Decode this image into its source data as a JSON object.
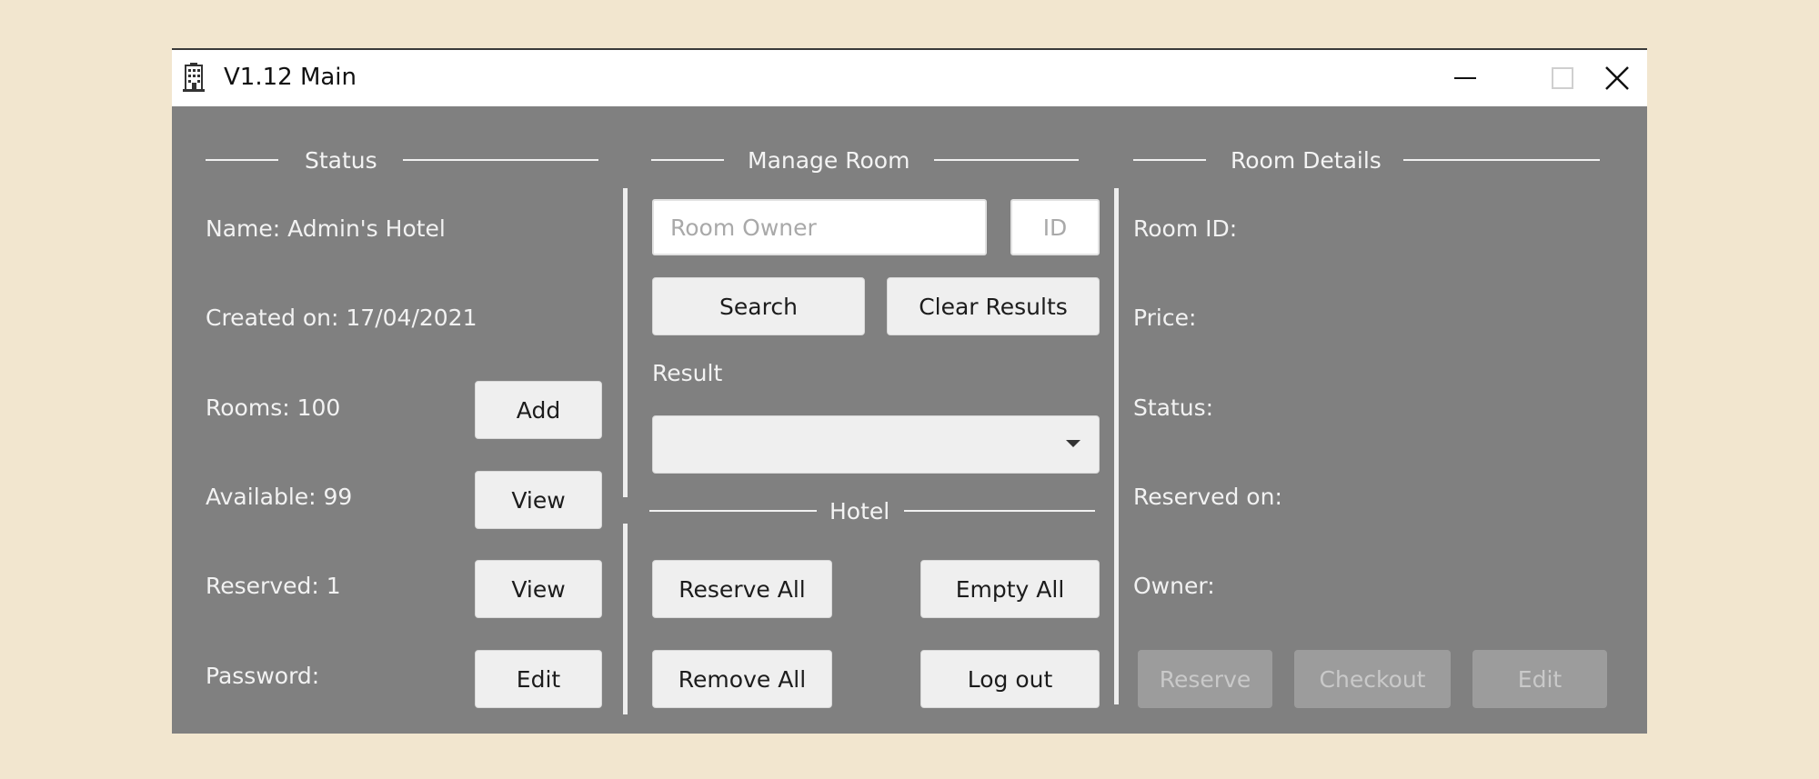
{
  "window": {
    "title": "V1.12 Main",
    "controls": {
      "minimize_icon": "minimize-icon",
      "maximize_icon": "maximize-icon",
      "close_icon": "close-icon"
    }
  },
  "status": {
    "heading": "Status",
    "name": "Name: Admin's Hotel",
    "created": "Created on: 17/04/2021",
    "rooms": "Rooms: 100",
    "rooms_button": "Add",
    "available": "Available: 99",
    "available_button": "View",
    "reserved": "Reserved: 1",
    "reserved_button": "View",
    "password": "Password:",
    "password_button": "Edit"
  },
  "manage_room": {
    "heading": "Manage Room",
    "owner_placeholder": "Room Owner",
    "id_placeholder": "ID",
    "search_button": "Search",
    "clear_button": "Clear Results",
    "result_label": "Result",
    "result_value": ""
  },
  "hotel": {
    "heading": "Hotel",
    "reserve_all": "Reserve All",
    "empty_all": "Empty All",
    "remove_all": "Remove All",
    "log_out": "Log out"
  },
  "room_details": {
    "heading": "Room Details",
    "room_id": "Room ID:",
    "price": "Price:",
    "status": "Status:",
    "reserved_on": "Reserved on:",
    "owner": "Owner:",
    "reserve_button": "Reserve",
    "checkout_button": "Checkout",
    "edit_button": "Edit"
  },
  "colors": {
    "background": "#f2e6cf",
    "window_body": "#808080",
    "title_bar": "#ffffff",
    "button": "#efefef",
    "button_disabled": "#9c9c9c"
  }
}
